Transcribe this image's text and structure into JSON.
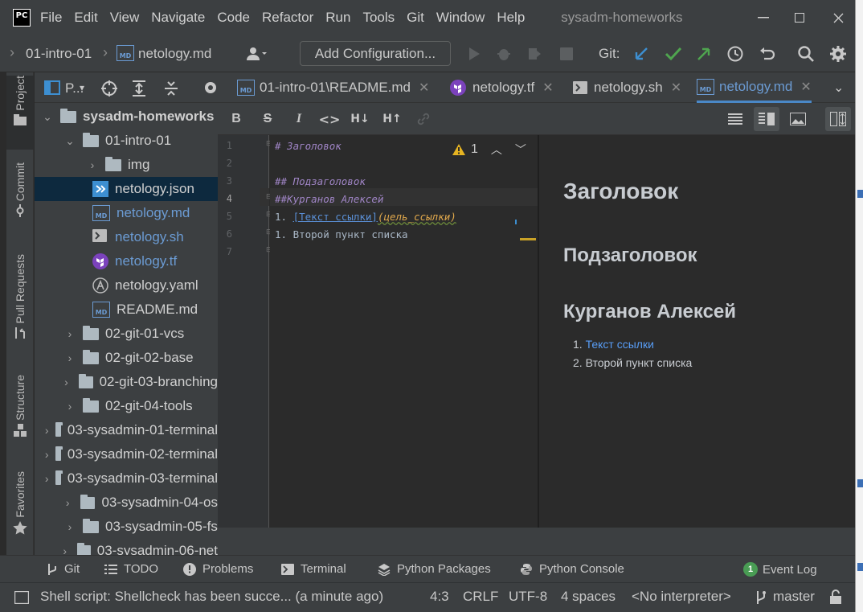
{
  "app": {
    "icon_text": "PC",
    "project_title": "sysadm-homeworks",
    "menu": [
      "File",
      "Edit",
      "View",
      "Navigate",
      "Code",
      "Refactor",
      "Run",
      "Tools",
      "Git",
      "Window",
      "Help"
    ]
  },
  "navbar": {
    "breadcrumb_folder": "01-intro-01",
    "breadcrumb_file": "netology.md",
    "add_config_label": "Add Configuration...",
    "git_label": "Git:"
  },
  "stripe": {
    "project": "Project",
    "commit": "Commit",
    "pull_requests": "Pull Requests",
    "structure": "Structure",
    "favorites": "Favorites"
  },
  "project_panel": {
    "title": "P..."
  },
  "tree": [
    {
      "label": "sysadm-homeworks",
      "type": "folder",
      "depth": 0,
      "arrow": "down",
      "bold": true
    },
    {
      "label": "01-intro-01",
      "type": "folder",
      "depth": 1,
      "arrow": "down"
    },
    {
      "label": "img",
      "type": "folder",
      "depth": 2,
      "arrow": "right"
    },
    {
      "label": "netology.json",
      "type": "json",
      "depth": 2,
      "selected": true
    },
    {
      "label": "netology.md",
      "type": "md",
      "depth": 2,
      "blue": true
    },
    {
      "label": "netology.sh",
      "type": "sh",
      "depth": 2,
      "blue": true
    },
    {
      "label": "netology.tf",
      "type": "tf",
      "depth": 2,
      "blue": true
    },
    {
      "label": "netology.yaml",
      "type": "yaml",
      "depth": 2
    },
    {
      "label": "README.md",
      "type": "md",
      "depth": 2
    },
    {
      "label": "02-git-01-vcs",
      "type": "folder",
      "depth": 1,
      "arrow": "right"
    },
    {
      "label": "02-git-02-base",
      "type": "folder",
      "depth": 1,
      "arrow": "right"
    },
    {
      "label": "02-git-03-branching",
      "type": "folder",
      "depth": 1,
      "arrow": "right"
    },
    {
      "label": "02-git-04-tools",
      "type": "folder",
      "depth": 1,
      "arrow": "right"
    },
    {
      "label": "03-sysadmin-01-terminal",
      "type": "folder",
      "depth": 1,
      "arrow": "right"
    },
    {
      "label": "03-sysadmin-02-terminal",
      "type": "folder",
      "depth": 1,
      "arrow": "right"
    },
    {
      "label": "03-sysadmin-03-terminal",
      "type": "folder",
      "depth": 1,
      "arrow": "right"
    },
    {
      "label": "03-sysadmin-04-os",
      "type": "folder",
      "depth": 1,
      "arrow": "right"
    },
    {
      "label": "03-sysadmin-05-fs",
      "type": "folder",
      "depth": 1,
      "arrow": "right"
    },
    {
      "label": "03-sysadmin-06-net",
      "type": "folder",
      "depth": 1,
      "arrow": "right"
    }
  ],
  "tabs": [
    {
      "label": "01-intro-01\\README.md",
      "icon": "md"
    },
    {
      "label": "netology.tf",
      "icon": "tf"
    },
    {
      "label": "netology.sh",
      "icon": "sh"
    },
    {
      "label": "netology.md",
      "icon": "md",
      "active": true
    }
  ],
  "md_toolbar": {
    "bold": "B",
    "strike": "S",
    "italic": "I",
    "code": "<>",
    "h_down": "H↓",
    "h_up": "H↑"
  },
  "editor": {
    "line_numbers": [
      "1",
      "2",
      "3",
      "4",
      "5",
      "6",
      "7"
    ],
    "line1": "# Заголовок",
    "line3": "## Подзаголовок",
    "line4": "##Курганов Алексей",
    "line5_prefix": "1. ",
    "line5_link_text": "[Текст ссылки]",
    "line5_link_dest": "(цель_ссылки)",
    "line6": "1. Второй пункт списка",
    "warning_count": "1"
  },
  "preview": {
    "h1": "Заголовок",
    "h2": "Подзаголовок",
    "h2b": "Курганов Алексей",
    "list": [
      {
        "num": "1.",
        "text": "Текст ссылки",
        "link": true
      },
      {
        "num": "2.",
        "text": "Второй пункт списка",
        "link": false
      }
    ]
  },
  "bottom_tabs": {
    "git": "Git",
    "todo": "TODO",
    "problems": "Problems",
    "terminal": "Terminal",
    "python_packages": "Python Packages",
    "python_console": "Python Console",
    "event_log": "Event Log",
    "event_count": "1"
  },
  "status": {
    "message": "Shell script: Shellcheck has been succe... (a minute ago)",
    "position": "4:3",
    "line_sep": "CRLF",
    "encoding": "UTF-8",
    "indent": "4 spaces",
    "interpreter": "<No interpreter>",
    "branch": "master"
  },
  "colors": {
    "accent": "#4a88c7",
    "background": "#2b2b2b",
    "panel": "#3c3f41",
    "link": "#5a8fd6",
    "warning": "#e6b422"
  }
}
